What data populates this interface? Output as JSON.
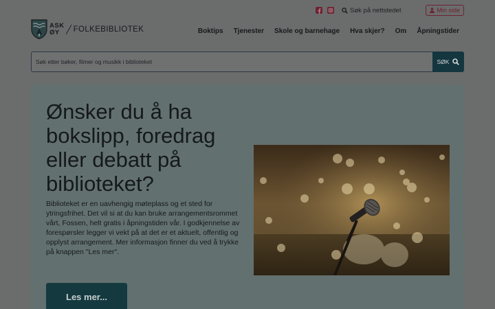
{
  "topbar": {
    "social": [
      {
        "name": "facebook",
        "icon": "facebook-icon"
      },
      {
        "name": "instagram",
        "icon": "instagram-icon"
      }
    ],
    "site_search": "Søk på nettstedet",
    "my_page": "Min side"
  },
  "logo": {
    "line1": "ASK",
    "line2": "ØY",
    "name": "FOLKEBIBLIOTEK"
  },
  "nav": [
    "Boktips",
    "Tjenester",
    "Skole og barnehage",
    "Hva skjer?",
    "Om",
    "Åpningstider"
  ],
  "search": {
    "placeholder": "Søk etter bøker, filmer og musikk i biblioteket",
    "button": "SØK"
  },
  "hero": {
    "title": "Ønsker du å ha bokslipp, foredrag eller debatt på biblioteket?",
    "body": "Biblioteket er en uavhengig møteplass og et sted for ytringsfrihet. Det vil si at du kan bruke arrangementsrommet vårt, Fossen, helt gratis i åpningstiden vår. I godkjennelse av forespørsler legger vi vekt på at det er et aktuelt, offentlig og opplyst arrangement. Mer informasjon finner du ved å trykke på knappen \"Les mer\".",
    "button": "Les mer...",
    "image": "microphone-on-stage-photo"
  },
  "colors": {
    "accent": "#6e2230",
    "dark_teal": "#14363f",
    "hero_bg": "#637070",
    "page_bg": "#6b6d6d"
  }
}
